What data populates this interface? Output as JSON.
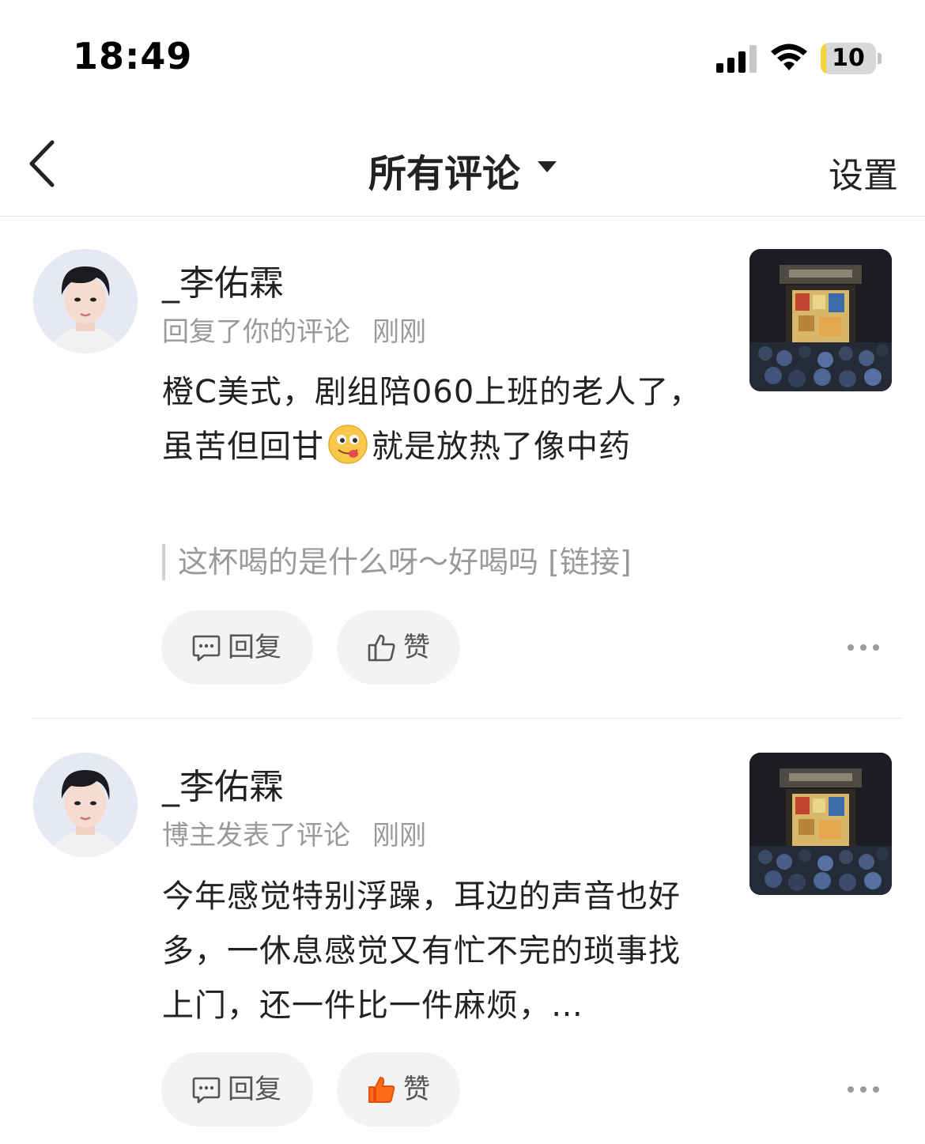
{
  "status_bar": {
    "time": "18:49",
    "battery_level": "10",
    "battery_fraction": 0.1,
    "battery_color": "#f7d33a",
    "icons": [
      "cellular-signal-icon",
      "wifi-icon",
      "battery-icon"
    ]
  },
  "nav": {
    "back_icon": "chevron-left-icon",
    "title": "所有评论",
    "title_dropdown_icon": "caret-down-icon",
    "settings_label": "设置"
  },
  "comments": [
    {
      "username": "_李佑霖",
      "action": "回复了你的评论",
      "time": "刚刚",
      "text_part1": "橙C美式，剧组陪060上班的老人了，虽苦但回甘",
      "emoji": "yummy-face-emoji",
      "text_part2": "就是放热了像中药",
      "quote": "这杯喝的是什么呀～好喝吗 [链接]",
      "reply_label": "回复",
      "like_label": "赞",
      "liked": false
    },
    {
      "username": "_李佑霖",
      "action": "博主发表了评论",
      "time": "刚刚",
      "text": "今年感觉特别浮躁，耳边的声音也好多，一休息感觉又有忙不完的琐事找上门，还一件比一件麻烦，…",
      "reply_label": "回复",
      "like_label": "赞",
      "liked": true,
      "like_color": "#ff6a1a"
    }
  ]
}
